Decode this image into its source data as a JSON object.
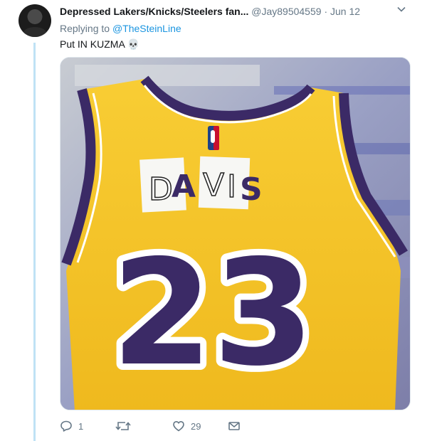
{
  "tweet": {
    "display_name": "Depressed Lakers/Knicks/Steelers fan...",
    "handle": "@Jay89504559",
    "separator": "·",
    "date": "Jun 12",
    "replying_to_label": "Replying to",
    "replying_to_handle": "@TheSteinLine",
    "text": "Put IN KUZMA 💀"
  },
  "media": {
    "jersey_name_letters": [
      "D",
      "A",
      "V",
      "I",
      "S"
    ],
    "jersey_number": "23",
    "logo_text": "NBA",
    "colors": {
      "jersey": "#f6c52a",
      "trim": "#3b2a66",
      "paper": "#f7f7f4"
    }
  },
  "actions": {
    "reply_count": "1",
    "retweet_count": "",
    "like_count": "29",
    "message_count": ""
  },
  "icons": {
    "reply": "reply-icon",
    "retweet": "retweet-icon",
    "like": "heart-icon",
    "dm": "envelope-icon",
    "menu": "chevron-down-icon"
  }
}
